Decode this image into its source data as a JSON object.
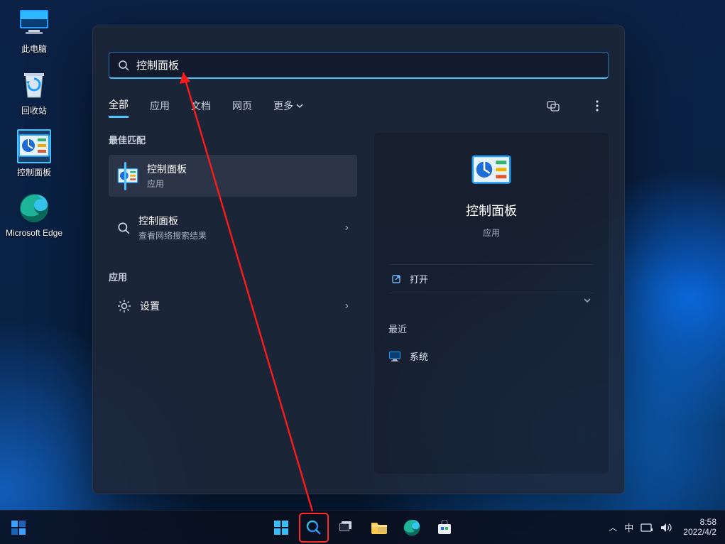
{
  "desktop": {
    "items": [
      {
        "label": "此电脑",
        "icon": "pc"
      },
      {
        "label": "回收站",
        "icon": "recycle"
      },
      {
        "label": "控制面板",
        "icon": "cpanel"
      },
      {
        "label": "Microsoft Edge",
        "icon": "edge"
      }
    ]
  },
  "search": {
    "query": "控制面板",
    "tabs": [
      "全部",
      "应用",
      "文档",
      "网页",
      "更多"
    ],
    "best_match_header": "最佳匹配",
    "apps_header": "应用",
    "results": {
      "best": {
        "title": "控制面板",
        "sub": "应用"
      },
      "web": {
        "title": "控制面板",
        "sub": "查看网络搜索结果"
      },
      "app": {
        "title": "设置"
      }
    },
    "detail": {
      "title": "控制面板",
      "sub": "应用",
      "open": "打开",
      "recent_header": "最近",
      "recent_item": "系统"
    }
  },
  "taskbar": {
    "chevron": "︿",
    "ime": "中",
    "time": "8:58",
    "date": "2022/4/2"
  }
}
